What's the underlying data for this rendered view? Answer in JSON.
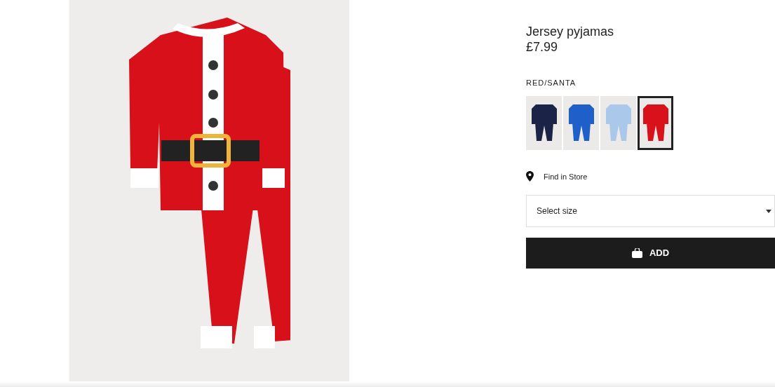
{
  "product": {
    "title": "Jersey pyjamas",
    "price": "£7.99",
    "color_label": "RED/SANTA"
  },
  "swatches": [
    {
      "color": "#1b2447",
      "selected": false
    },
    {
      "color": "#1f5fc9",
      "selected": false
    },
    {
      "color": "#a9c8ea",
      "selected": false
    },
    {
      "color": "#d9111b",
      "selected": true
    }
  ],
  "find_in_store": "Find in Store",
  "size_select": {
    "placeholder": "Select size"
  },
  "add_button": "ADD"
}
